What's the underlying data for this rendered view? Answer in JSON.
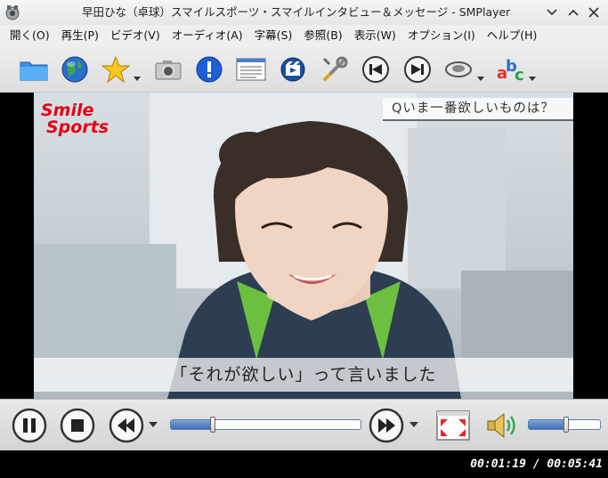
{
  "window": {
    "title": "早田ひな（卓球）スマイルスポーツ・スマイルインタビュー＆メッセージ - SMPlayer",
    "controls": [
      "minimize",
      "maximize",
      "close"
    ]
  },
  "menu": {
    "items": [
      {
        "label": "開く(O)"
      },
      {
        "label": "再生(P)"
      },
      {
        "label": "ビデオ(V)"
      },
      {
        "label": "オーディオ(A)"
      },
      {
        "label": "字幕(S)"
      },
      {
        "label": "参照(B)"
      },
      {
        "label": "表示(W)"
      },
      {
        "label": "オプション(I)"
      },
      {
        "label": "ヘルプ(H)"
      }
    ]
  },
  "toolbar": {
    "icons": [
      "open-folder-icon",
      "open-url-icon",
      "favorites-icon",
      "screenshot-icon",
      "info-icon",
      "playlist-icon",
      "media-preferences-icon",
      "preferences-icon",
      "previous-icon",
      "next-icon",
      "audio-track-icon",
      "subtitle-track-icon"
    ]
  },
  "video": {
    "logo": {
      "line1": "Smile",
      "line2": "Sports"
    },
    "question": "Qいま一番欲しいものは？",
    "subtitle": "「それが欲しい」って言いました"
  },
  "controls": {
    "seek_fraction": 0.22,
    "volume_fraction": 0.52
  },
  "status": {
    "time": "00:01:19 / 00:05:41"
  },
  "colors": {
    "logo_red": "#e60012",
    "slider_blue": "#3d6db3"
  }
}
